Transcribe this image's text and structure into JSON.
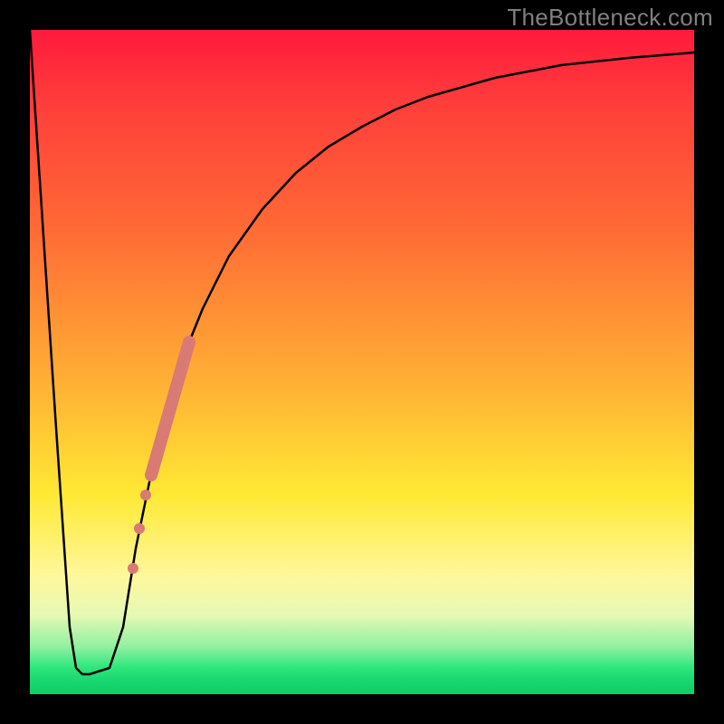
{
  "watermark": "TheBottleneck.com",
  "colors": {
    "curve": "#000000",
    "marker": "#d97a74",
    "background_top": "#ff1a3d",
    "background_bottom": "#0fcf67"
  },
  "chart_data": {
    "type": "line",
    "title": "",
    "xlabel": "",
    "ylabel": "",
    "xlim": [
      0,
      100
    ],
    "ylim": [
      0,
      100
    ],
    "grid": false,
    "legend": false,
    "series": [
      {
        "name": "bottleneck-curve",
        "x": [
          0,
          4,
          6,
          7,
          8,
          9,
          12,
          14,
          16,
          18,
          20,
          22,
          24,
          26,
          30,
          35,
          40,
          45,
          50,
          55,
          60,
          70,
          80,
          90,
          100
        ],
        "values": [
          100,
          40,
          10,
          4,
          3,
          3,
          4,
          10,
          22,
          32,
          40,
          47,
          53,
          58,
          66,
          73,
          78.5,
          82.5,
          85.5,
          88,
          90,
          92.8,
          94.7,
          95.8,
          96.6
        ]
      }
    ],
    "markers": {
      "name": "highlight-segment",
      "color": "#d97a74",
      "points": [
        {
          "x": 15.5,
          "y": 19,
          "r": 6
        },
        {
          "x": 16.5,
          "y": 25,
          "r": 6
        },
        {
          "x": 17.5,
          "y": 30,
          "r": 6
        }
      ],
      "thick_segment": {
        "x0": 18.2,
        "y0": 33,
        "x1": 24,
        "y1": 53,
        "width": 14
      }
    }
  }
}
